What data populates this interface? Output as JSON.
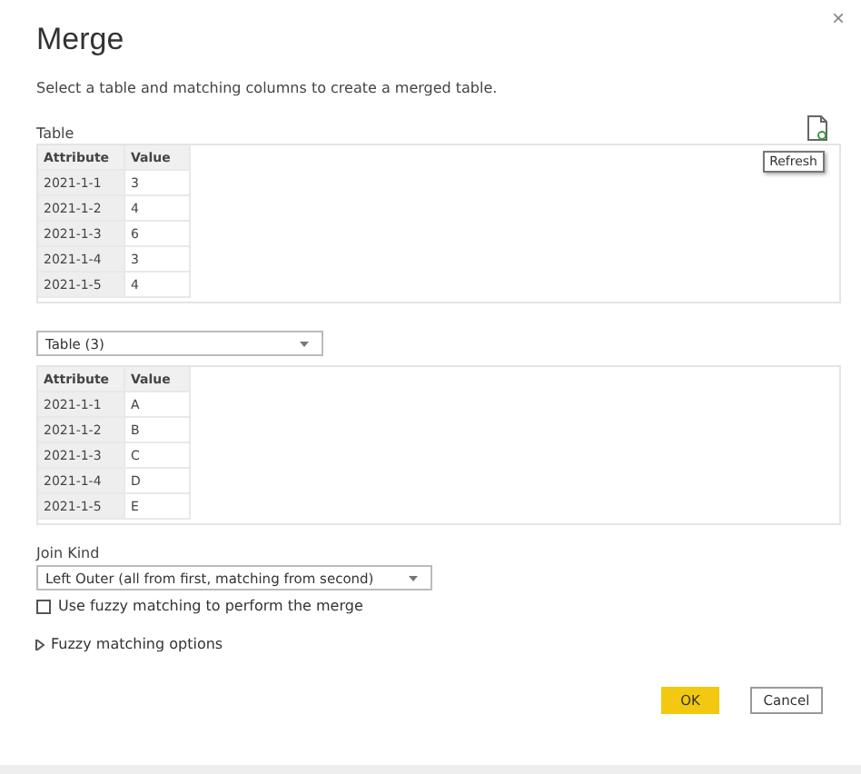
{
  "dialog": {
    "title": "Merge",
    "description": "Select a table and matching columns to create a merged table.",
    "close": "×"
  },
  "first_table": {
    "label": "Table",
    "tooltip": "Refresh",
    "columns": [
      "Attribute",
      "Value"
    ],
    "rows": [
      [
        "2021-1-1",
        "3"
      ],
      [
        "2021-1-2",
        "4"
      ],
      [
        "2021-1-3",
        "6"
      ],
      [
        "2021-1-4",
        "3"
      ],
      [
        "2021-1-5",
        "4"
      ]
    ]
  },
  "second_table": {
    "selector": "Table (3)",
    "columns": [
      "Attribute",
      "Value"
    ],
    "rows": [
      [
        "2021-1-1",
        "A"
      ],
      [
        "2021-1-2",
        "B"
      ],
      [
        "2021-1-3",
        "C"
      ],
      [
        "2021-1-4",
        "D"
      ],
      [
        "2021-1-5",
        "E"
      ]
    ]
  },
  "join_kind": {
    "label": "Join Kind",
    "value": "Left Outer (all from first, matching from second)"
  },
  "fuzzy": {
    "label": "Use fuzzy matching to perform the merge",
    "checked": false
  },
  "fuzzy_options": {
    "label": "Fuzzy matching options",
    "expanded": false
  },
  "buttons": [
    {
      "label": "OK",
      "kind": "primary"
    },
    {
      "label": "Cancel",
      "kind": "secondary"
    }
  ]
}
